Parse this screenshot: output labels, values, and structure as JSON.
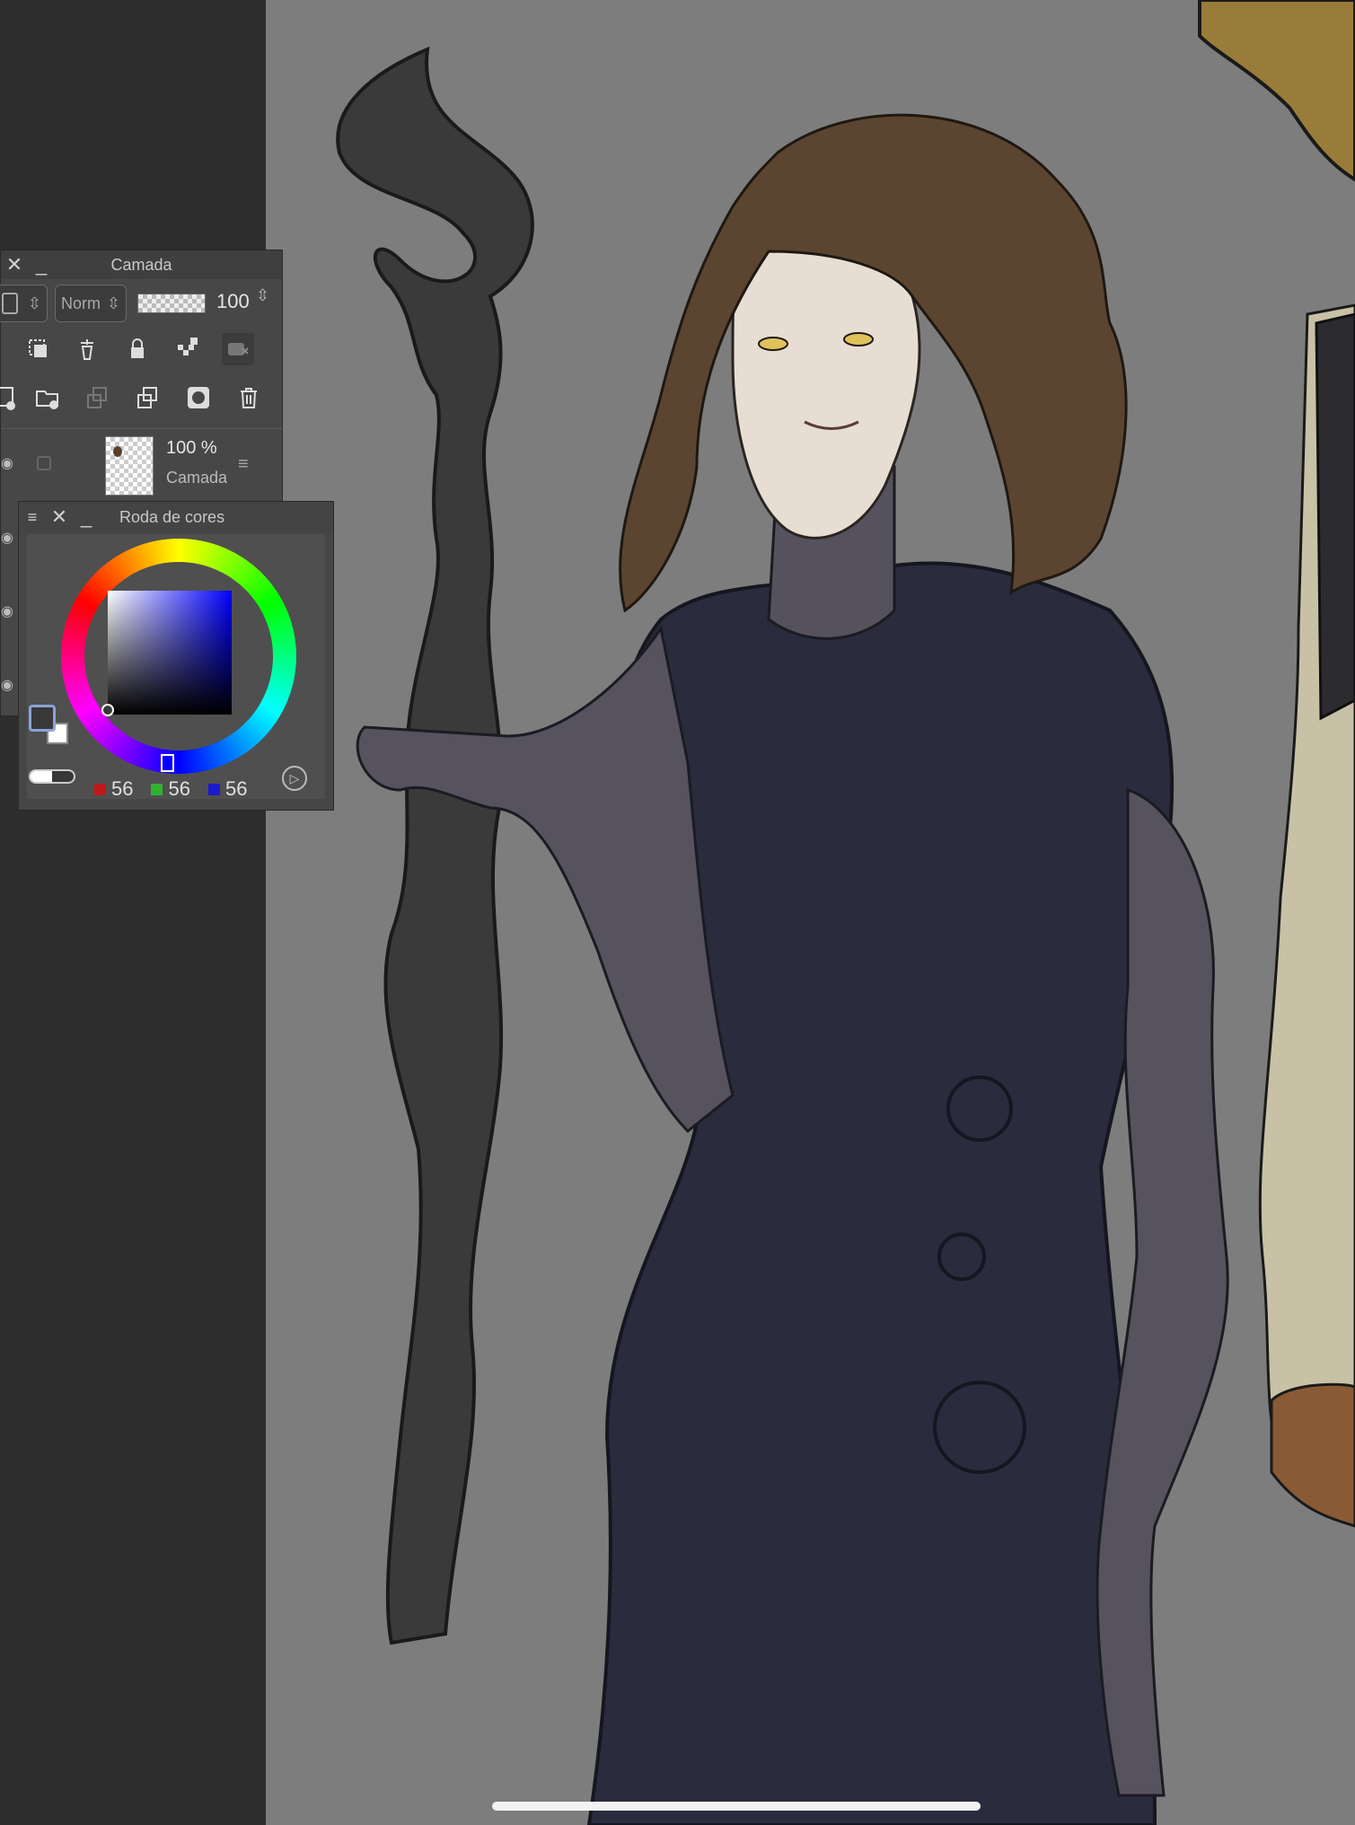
{
  "layer_panel": {
    "title": "Camada",
    "blend_mode": "Norm",
    "opacity_value": "100",
    "layer": {
      "opacity": "100 %",
      "name": "Camada"
    }
  },
  "color_panel": {
    "title": "Roda de cores",
    "selected_hue": "#0000ff",
    "current_color": "#383838",
    "rgb": {
      "r": "56",
      "g": "56",
      "b": "56"
    }
  },
  "colors": {
    "background": "#7d7d7d",
    "panel": "#474747",
    "robe": "#2a2b3d",
    "skin": "#56525e"
  }
}
